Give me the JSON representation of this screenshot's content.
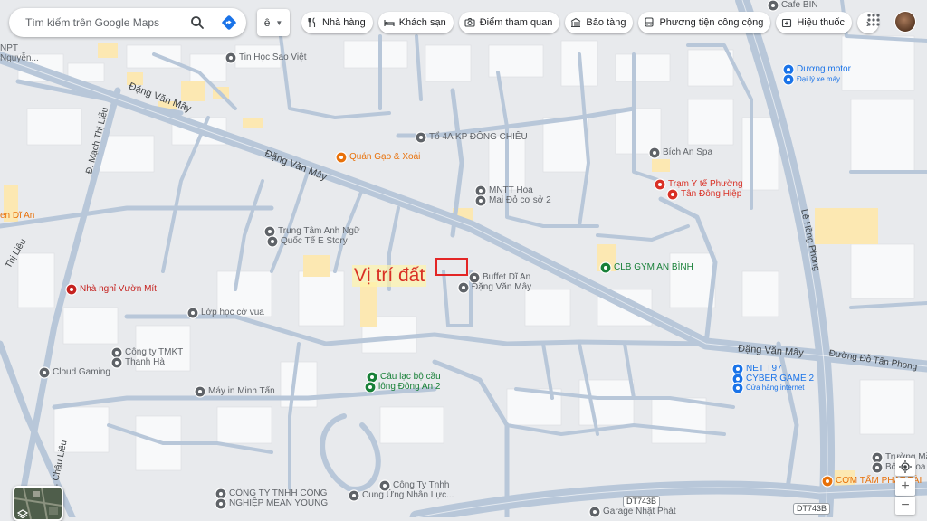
{
  "search": {
    "placeholder": "Tìm kiếm trên Google Maps"
  },
  "language_button": "ê",
  "chips": [
    {
      "label": "Nhà hàng",
      "icon": "fork-knife-icon"
    },
    {
      "label": "Khách sạn",
      "icon": "bed-icon"
    },
    {
      "label": "Điểm tham quan",
      "icon": "camera-icon"
    },
    {
      "label": "Bảo tàng",
      "icon": "museum-icon"
    },
    {
      "label": "Phương tiện công cộng",
      "icon": "bus-icon"
    },
    {
      "label": "Hiệu thuốc",
      "icon": "pharmacy-icon"
    }
  ],
  "annotation": {
    "text": "Vị trí đất",
    "color": "#d93025"
  },
  "streets": [
    {
      "text": "Đặng Văn Mây"
    },
    {
      "text": "Đặng Văn Mây"
    },
    {
      "text": "Đặng Văn Mây"
    },
    {
      "text": "Đường Đỗ Tấn Phong"
    },
    {
      "text": "Lê Hồng Phong"
    },
    {
      "text": "Đ. Mạch Thị Liễu"
    },
    {
      "text": "Đ. Châu Liêu"
    },
    {
      "text": "Thị Liêu"
    },
    {
      "text": "DT743B"
    },
    {
      "text": "DT743B"
    }
  ],
  "pois": [
    {
      "name": "Tin Học Sao Việt",
      "color": "#5f6368"
    },
    {
      "name": "Cafe BIN",
      "color": "#5f6368"
    },
    {
      "name": "Dương motor",
      "color": "#1a73e8"
    },
    {
      "name": "Đại lý xe máy",
      "color": "#1a73e8"
    },
    {
      "name": "NPT",
      "color": "#5f6368"
    },
    {
      "name": "Nguyễn...",
      "color": "#5f6368"
    },
    {
      "name": "Tổ 4A KP ĐÔNG CHIÊU",
      "color": "#5f6368"
    },
    {
      "name": "Quán Gạo & Xoài",
      "color": "#e8710a"
    },
    {
      "name": "Bích An Spa",
      "color": "#5f6368"
    },
    {
      "name": "Trạm Y tế Phường",
      "color": "#d93025"
    },
    {
      "name": "Tân Đông Hiệp",
      "color": "#d93025"
    },
    {
      "name": "MNTT Hoa",
      "color": "#5f6368"
    },
    {
      "name": "Mai Đỏ cơ sở 2",
      "color": "#5f6368"
    },
    {
      "name": "en Dĩ An",
      "color": "#e8710a"
    },
    {
      "name": "Trung Tâm Anh Ngữ",
      "color": "#5f6368"
    },
    {
      "name": "Quốc Tế E Story",
      "color": "#5f6368"
    },
    {
      "name": "Buffet Dĩ An",
      "color": "#5f6368"
    },
    {
      "name": "Đặng Văn Mây",
      "color": "#5f6368"
    },
    {
      "name": "CLB GYM AN BÌNH",
      "color": "#188038"
    },
    {
      "name": "Nhà nghỉ Vườn Mít",
      "color": "#c5221f"
    },
    {
      "name": "Lớp học cờ vua",
      "color": "#5f6368"
    },
    {
      "name": "Công ty TMKT",
      "color": "#5f6368"
    },
    {
      "name": "Thanh Hà",
      "color": "#5f6368"
    },
    {
      "name": "Cloud Gaming",
      "color": "#5f6368"
    },
    {
      "name": "Câu lạc bộ cầu",
      "color": "#188038"
    },
    {
      "name": "lông Đông An 2",
      "color": "#188038"
    },
    {
      "name": "NET T97",
      "color": "#1a73e8"
    },
    {
      "name": "CYBER GAME 2",
      "color": "#1a73e8"
    },
    {
      "name": "Cửa hàng internet",
      "color": "#1a73e8"
    },
    {
      "name": "Máy in Minh Tấn",
      "color": "#5f6368"
    },
    {
      "name": "Trường Mầ",
      "color": "#5f6368"
    },
    {
      "name": "Bông Hoa",
      "color": "#5f6368"
    },
    {
      "name": "CƠM TẤM PHÁT TÀI",
      "color": "#e8710a"
    },
    {
      "name": "CÔNG TY TNHH CÔNG",
      "color": "#5f6368"
    },
    {
      "name": "NGHIỆP MEAN YOUNG",
      "color": "#5f6368"
    },
    {
      "name": "Công Ty Tnhh",
      "color": "#5f6368"
    },
    {
      "name": "Cung Ứng Nhân Lực...",
      "color": "#5f6368"
    },
    {
      "name": "Garage Nhật Phát",
      "color": "#5f6368"
    }
  ],
  "controls": {
    "zoom_in": "+",
    "zoom_out": "−"
  },
  "colors": {
    "road": "#b8c7d9",
    "background": "#e8eaed",
    "building": "#f8f9fa",
    "highlight": "#fce8b2",
    "marker": "#e32626"
  }
}
